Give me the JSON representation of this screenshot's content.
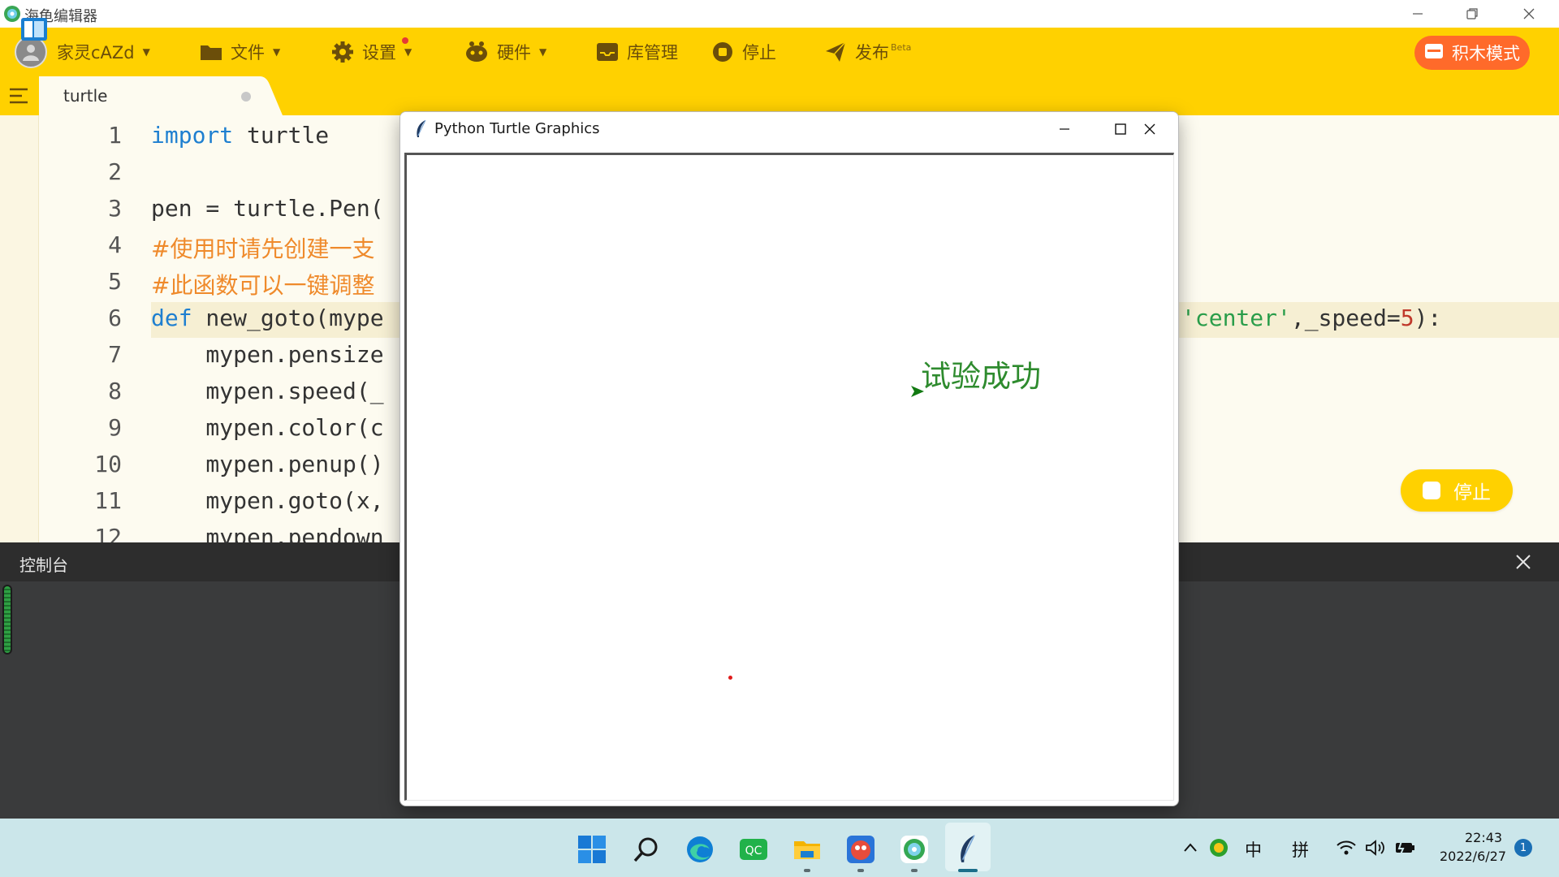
{
  "app": {
    "title": "海龟编辑器"
  },
  "toolbar": {
    "user": "家灵cAZd",
    "file": "文件",
    "settings": "设置",
    "hardware": "硬件",
    "library": "库管理",
    "stop": "停止",
    "publish": "发布",
    "publish_badge": "Beta",
    "block_mode": "积木模式"
  },
  "tab": {
    "label": "turtle"
  },
  "editor": {
    "line_numbers": [
      "1",
      "2",
      "3",
      "4",
      "5",
      "6",
      "7",
      "8",
      "9",
      "10",
      "11",
      "12"
    ],
    "line1": {
      "kw": "import",
      "rest": " turtle"
    },
    "line3": "pen = turtle.Pen(",
    "line4": "#使用时请先创建一支",
    "line5": "#此函数可以一键调整",
    "line6": {
      "kw": "def",
      "name": " new_goto(mype",
      "tail_pre": "'center'",
      "tail_mid": ",_speed=",
      "tail_num": "5",
      "tail_end": "):"
    },
    "line7": "    mypen.pensize",
    "line8": "    mypen.speed(_",
    "line9": "    mypen.color(c",
    "line10": "    mypen.penup()",
    "line11": "    mypen.goto(x,",
    "line12": "    mypen.pendown",
    "float_stop": "停止"
  },
  "console": {
    "title": "控制台"
  },
  "turtle_window": {
    "title": "Python Turtle Graphics",
    "canvas_text": "试验成功",
    "text_color": "#2e8b2e",
    "dot_color": "#e01b1b"
  },
  "taskbar": {
    "icons": [
      "windows-start-icon",
      "search-icon",
      "edge-icon",
      "qq-music-icon",
      "file-explorer-icon",
      "game-icon",
      "turtle-editor-icon",
      "python-feather-icon"
    ],
    "ime_mode": "中",
    "ime_input": "拼",
    "time": "22:43",
    "date": "2022/6/27",
    "notifications": "1"
  },
  "colors": {
    "accent": "#FFD100",
    "block_mode_button": "#FF6A2A",
    "console_bg": "#3a3b3c"
  }
}
